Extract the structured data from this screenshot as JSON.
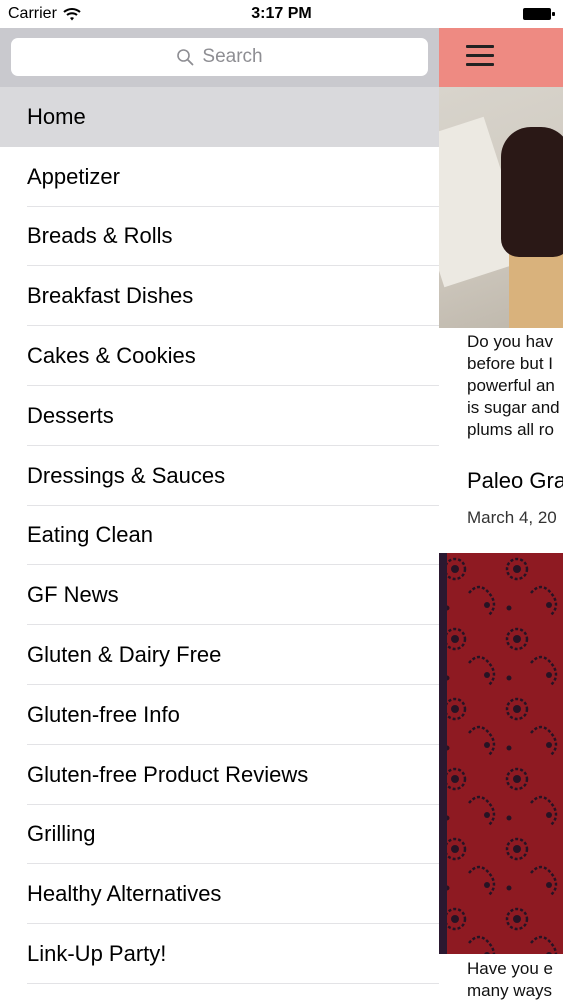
{
  "status_bar": {
    "carrier": "Carrier",
    "time": "3:17 PM"
  },
  "search": {
    "placeholder": "Search"
  },
  "menu": {
    "items": [
      {
        "label": "Home",
        "active": true
      },
      {
        "label": "Appetizer"
      },
      {
        "label": "Breads & Rolls"
      },
      {
        "label": "Breakfast Dishes"
      },
      {
        "label": "Cakes & Cookies"
      },
      {
        "label": "Desserts"
      },
      {
        "label": "Dressings & Sauces"
      },
      {
        "label": "Eating Clean"
      },
      {
        "label": "GF News"
      },
      {
        "label": "Gluten & Dairy Free"
      },
      {
        "label": "Gluten-free Info"
      },
      {
        "label": "Gluten-free Product Reviews"
      },
      {
        "label": "Grilling"
      },
      {
        "label": "Healthy Alternatives"
      },
      {
        "label": "Link-Up Party!"
      }
    ]
  },
  "content": {
    "nav_color": "#ee8a82",
    "excerpt_1": [
      "Do you hav",
      "before but I",
      "powerful an",
      "is sugar and",
      "plums all ro"
    ],
    "post_title": "Paleo Gra",
    "post_date": "March 4, 20",
    "excerpt_2": [
      "Have you e",
      "many ways"
    ]
  }
}
